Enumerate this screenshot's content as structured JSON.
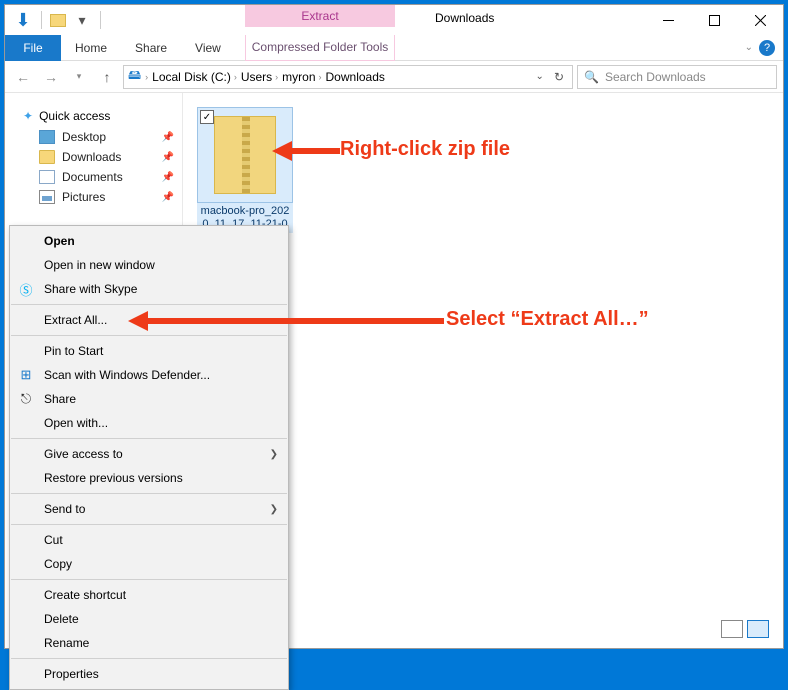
{
  "window": {
    "context_tab": "Extract",
    "context_tools": "Compressed Folder Tools",
    "title": "Downloads"
  },
  "ribbon": {
    "file": "File",
    "tabs": [
      "Home",
      "Share",
      "View"
    ]
  },
  "address": {
    "crumbs": [
      "Local Disk (C:)",
      "Users",
      "myron",
      "Downloads"
    ]
  },
  "search": {
    "placeholder": "Search Downloads"
  },
  "nav": {
    "quick_access": "Quick access",
    "items": [
      {
        "label": "Desktop"
      },
      {
        "label": "Downloads"
      },
      {
        "label": "Documents"
      },
      {
        "label": "Pictures"
      }
    ]
  },
  "file": {
    "name": "macbook-pro_2020_11_17_11-21-0"
  },
  "context_menu": {
    "open": "Open",
    "open_new": "Open in new window",
    "skype": "Share with Skype",
    "extract_all": "Extract All...",
    "pin_start": "Pin to Start",
    "defender": "Scan with Windows Defender...",
    "share": "Share",
    "open_with": "Open with...",
    "give_access": "Give access to",
    "restore": "Restore previous versions",
    "send_to": "Send to",
    "cut": "Cut",
    "copy": "Copy",
    "shortcut": "Create shortcut",
    "delete": "Delete",
    "rename": "Rename",
    "properties": "Properties"
  },
  "annotations": {
    "a1": "Right-click zip file",
    "a2": "Select “Extract All…”"
  }
}
